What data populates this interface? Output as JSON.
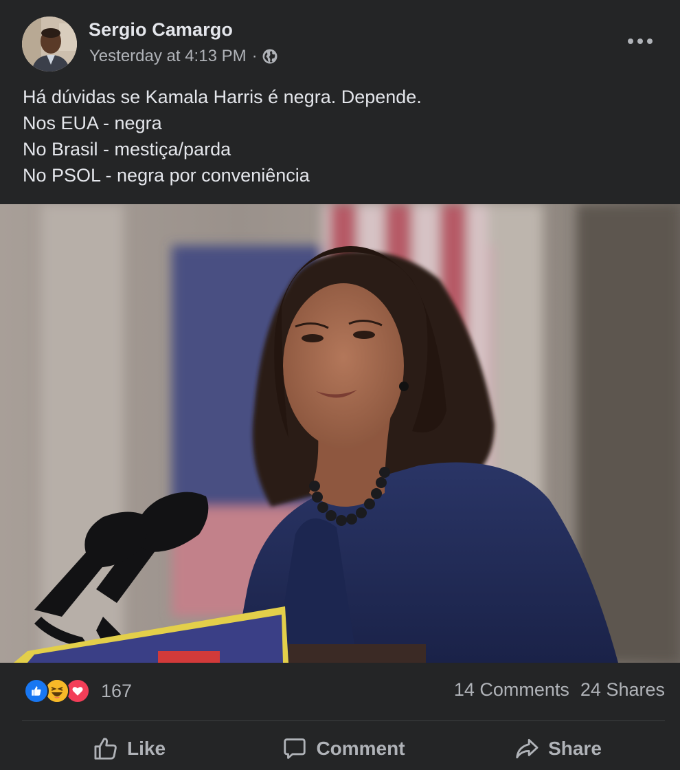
{
  "post": {
    "author": "Sergio Camargo",
    "timestamp": "Yesterday at 4:13 PM",
    "separator": "·",
    "privacy_icon": "globe-icon",
    "more_icon": "more-horizontal-icon",
    "text_lines": [
      "Há dúvidas se Kamala Harris é negra. Depende.",
      "Nos EUA - negra",
      "No Brasil - mestiça/parda",
      "No PSOL - negra por conveniência"
    ]
  },
  "stats": {
    "reaction_icons": [
      "like-reaction-icon",
      "haha-reaction-icon",
      "love-reaction-icon"
    ],
    "reaction_count": "167",
    "comments": "14 Comments",
    "shares": "24 Shares"
  },
  "actions": {
    "like": "Like",
    "comment": "Comment",
    "share": "Share"
  },
  "colors": {
    "background": "#242526",
    "text_primary": "#e4e6eb",
    "text_secondary": "#b0b3b8",
    "like_blue": "#1877f2",
    "haha_yellow": "#f7b928",
    "love_red": "#f33e58"
  }
}
